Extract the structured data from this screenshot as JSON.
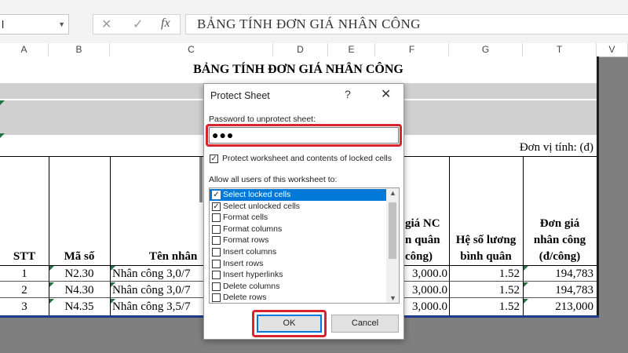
{
  "formula_bar": {
    "name_box": "l",
    "cancel_icon": "✕",
    "enter_icon": "✓",
    "fx_icon": "fx",
    "content": "BẢNG TÍNH ĐƠN GIÁ NHÂN CÔNG"
  },
  "columns": [
    "A",
    "B",
    "C",
    "D",
    "E",
    "F",
    "G",
    "T",
    "V"
  ],
  "sheet": {
    "title": "BẢNG TÍNH ĐƠN GIÁ NHÂN CÔNG",
    "unit": "Đơn vị tính:  (đ)",
    "headers": {
      "stt": "STT",
      "ma_so": "Mã số",
      "ten": "Tên nhân",
      "don_gia_nc_1": "giá NC",
      "don_gia_nc_2": "n quân",
      "don_gia_nc_3": "công)",
      "he_so_1": "Hệ số lương",
      "he_so_2": "bình quân",
      "don_gia_1": "Đơn giá",
      "don_gia_2": "nhân công",
      "don_gia_3": "(đ/công)"
    },
    "rows": [
      {
        "stt": "1",
        "ma_so": "N2.30",
        "ten": "Nhân công 3,0/7",
        "gia": "3,000.0",
        "he_so": "1.52",
        "don_gia": "194,783"
      },
      {
        "stt": "2",
        "ma_so": "N4.30",
        "ten": "Nhân công 3,0/7",
        "gia": "3,000.0",
        "he_so": "1.52",
        "don_gia": "194,783"
      },
      {
        "stt": "3",
        "ma_so": "N4.35",
        "ten": "Nhân công 3,5/7",
        "gia": "3,000.0",
        "he_so": "1.52",
        "don_gia": "213,000"
      }
    ]
  },
  "dialog": {
    "title": "Protect Sheet",
    "help": "?",
    "close": "✕",
    "password_label": "Password to unprotect sheet:",
    "password_value": "●●●",
    "protect_label": "Protect worksheet and contents of locked cells",
    "protect_checked": true,
    "allow_label": "Allow all users of this worksheet to:",
    "options": [
      {
        "label": "Select locked cells",
        "checked": true,
        "selected": true
      },
      {
        "label": "Select unlocked cells",
        "checked": true,
        "selected": false
      },
      {
        "label": "Format cells",
        "checked": false,
        "selected": false
      },
      {
        "label": "Format columns",
        "checked": false,
        "selected": false
      },
      {
        "label": "Format rows",
        "checked": false,
        "selected": false
      },
      {
        "label": "Insert columns",
        "checked": false,
        "selected": false
      },
      {
        "label": "Insert rows",
        "checked": false,
        "selected": false
      },
      {
        "label": "Insert hyperlinks",
        "checked": false,
        "selected": false
      },
      {
        "label": "Delete columns",
        "checked": false,
        "selected": false
      },
      {
        "label": "Delete rows",
        "checked": false,
        "selected": false
      }
    ],
    "ok_label": "OK",
    "cancel_label": "Cancel"
  },
  "colors": {
    "highlight": "#d9232d",
    "selection": "#0078d7",
    "excel_green": "#217346"
  }
}
